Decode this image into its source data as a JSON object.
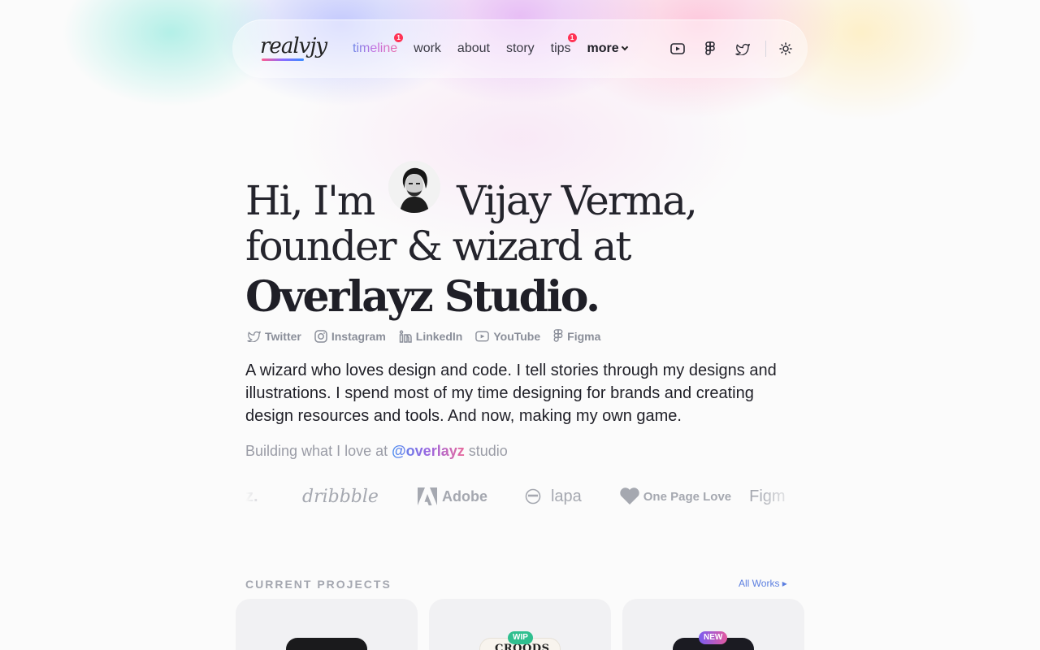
{
  "nav": {
    "logo_text": "realvjy",
    "links": [
      {
        "label": "timeline",
        "badge": "1"
      },
      {
        "label": "work"
      },
      {
        "label": "about"
      },
      {
        "label": "story"
      },
      {
        "label": "tips",
        "badge": "1"
      },
      {
        "label": "more"
      }
    ],
    "icons": [
      "youtube-icon",
      "figma-icon",
      "twitter-icon",
      "sun-icon"
    ]
  },
  "hero": {
    "line1_a": "Hi, I'm",
    "line1_b": "Vijay Verma,",
    "line2": "founder & wizard at",
    "line3": "Overlayz Studio."
  },
  "socials": [
    {
      "label": "Twitter",
      "icon": "twitter-icon"
    },
    {
      "label": "Instagram",
      "icon": "instagram-icon"
    },
    {
      "label": "LinkedIn",
      "icon": "linkedin-icon"
    },
    {
      "label": "YouTube",
      "icon": "youtube-icon"
    },
    {
      "label": "Figma",
      "icon": "figma-icon"
    }
  ],
  "bio": "A wizard who loves design and code. I tell stories through my designs and illustrations. I spend most of my time designing for brands and creating design resources and tools. And now, making my own game.",
  "building": {
    "prefix": "Building what I love at",
    "handle": "@overlayz",
    "suffix": "studio"
  },
  "brands": [
    "z.",
    "dribbble",
    "Adobe",
    "lapa",
    "One Page Love",
    "Figm"
  ],
  "projects": {
    "title": "CURRENT PROJECTS",
    "all_works": "All Works ▸",
    "cards": [
      {
        "tag": ""
      },
      {
        "tag": "WIP",
        "tag_color": "#2fbf8f",
        "thumb_text": "CROODS"
      },
      {
        "tag": "NEW",
        "tag_color": "#9a55e0"
      }
    ]
  },
  "colors": {
    "accent_blue": "#5c7fe0",
    "badge_red": "#ff3355",
    "muted": "#8a8e99"
  }
}
